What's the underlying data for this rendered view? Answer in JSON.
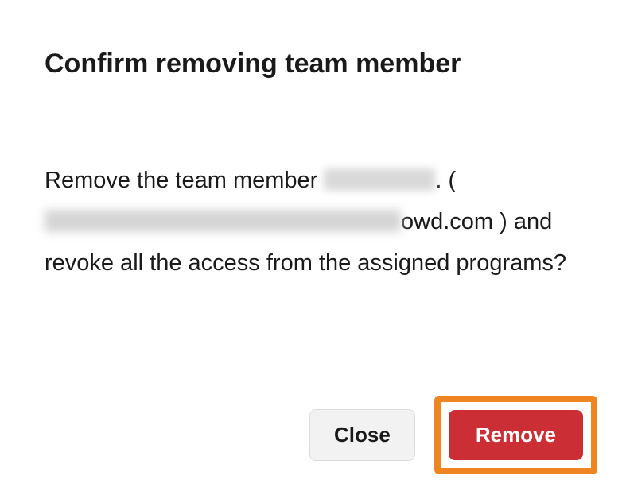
{
  "dialog": {
    "title": "Confirm removing team member",
    "body": {
      "prefix": "Remove the team member ",
      "name_redacted": true,
      "after_name": ". (",
      "email_redacted_prefix": true,
      "email_visible_suffix": "owd.com )",
      "suffix": " and revoke all the access from the assigned programs?"
    },
    "actions": {
      "close_label": "Close",
      "remove_label": "Remove"
    }
  }
}
